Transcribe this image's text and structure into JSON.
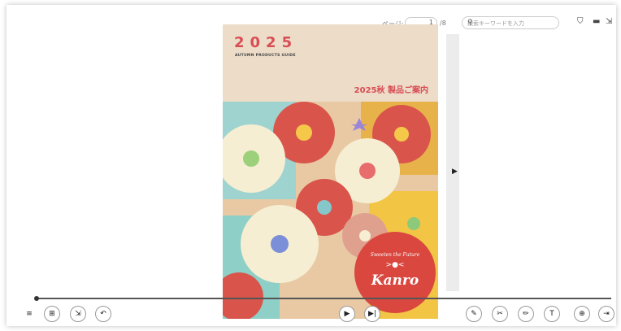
{
  "toolbar": {
    "page_label": "ページ:",
    "page_value": "1",
    "page_total": "/8",
    "search_placeholder": "検索キーワードを入力"
  },
  "cover": {
    "year": "2025",
    "subtitle": "AUTUMN PRODUCTS GUIDE",
    "title": "2025秋 製品ご案内",
    "badge_tagline": "Sweeten the Future",
    "brand": "Kanro"
  },
  "colors": {
    "accent": "#d94d55",
    "cover_head": "#ecdcc8"
  },
  "icons": {
    "menu": "≡",
    "thumbs": "⊞",
    "export": "⇲",
    "back": "↶",
    "play": "▶",
    "next": "▶|",
    "marker": "✎",
    "cut": "✂",
    "pen": "✏",
    "text": "T",
    "zoom": "⊕",
    "end": "⇥"
  }
}
